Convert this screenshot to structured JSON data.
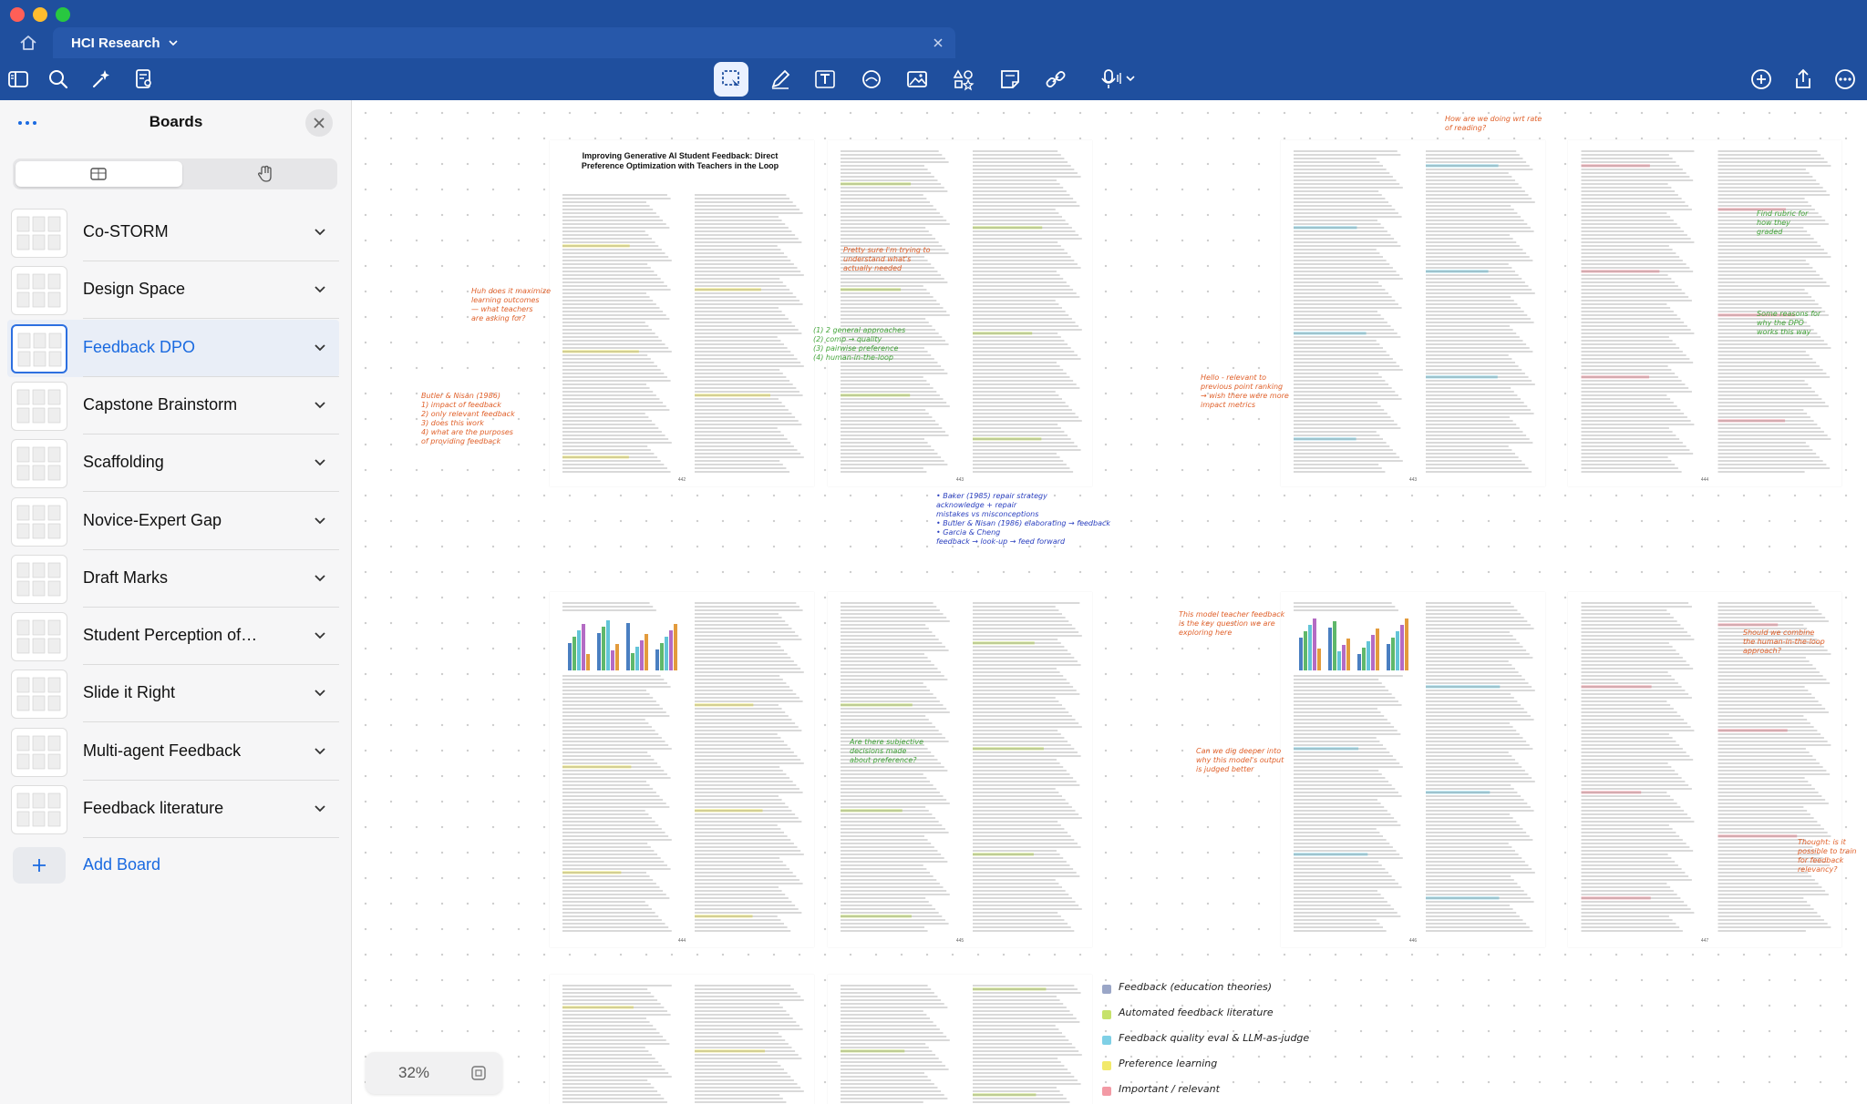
{
  "window": {
    "tab_title": "HCI Research"
  },
  "toolbar": {
    "left_icons": [
      "sidebar-icon",
      "search-icon",
      "sparkle-icon",
      "document-search-icon"
    ],
    "center_icons": [
      "lasso-icon",
      "pen-icon",
      "text-icon",
      "shape-icon",
      "image-icon",
      "elements-icon",
      "sticky-note-icon",
      "link-icon",
      "microphone-icon"
    ],
    "right_icons": [
      "add-icon",
      "share-icon",
      "more-icon"
    ],
    "accent": "#1f4f9e"
  },
  "sidebar": {
    "title": "Boards",
    "boards": [
      {
        "label": "Co-STORM",
        "active": false
      },
      {
        "label": "Design Space",
        "active": false
      },
      {
        "label": "Feedback DPO",
        "active": true
      },
      {
        "label": "Capstone Brainstorm",
        "active": false
      },
      {
        "label": "Scaffolding",
        "active": false
      },
      {
        "label": "Novice-Expert Gap",
        "active": false
      },
      {
        "label": "Draft Marks",
        "active": false
      },
      {
        "label": "Student Perception of…",
        "active": false
      },
      {
        "label": "Slide it Right",
        "active": false
      },
      {
        "label": "Multi-agent Feedback",
        "active": false
      },
      {
        "label": "Feedback literature",
        "active": false
      }
    ],
    "add_board_label": "Add Board",
    "active_color": "#1a6ae0"
  },
  "canvas": {
    "paper": {
      "title": "Improving Generative AI Student Feedback: Direct Preference Optimization with Teachers in the Loop",
      "authors": [
        "Juliette Woodrow",
        "Sanmi Koyejo",
        "Chris Piech"
      ],
      "affiliation": "Stanford University",
      "page_numbers": [
        "442",
        "443",
        "444",
        "445",
        "446",
        "447"
      ]
    },
    "sections": {
      "abstract": "ABSTRACT",
      "keywords": "Keywords",
      "intro": "1. INTRODUCTION",
      "methodology": "2. METHODOLOGY",
      "dpo": "2.1 Direct Preference Optimization",
      "experimental": "3. EXPERIMENTAL SETUP",
      "results": "4. RESULTS",
      "discussion": "5. DISCUSSION",
      "limitations": "6. LIMITATIONS",
      "future": "7. FUTURE WORK",
      "conclusion": "8. CONCLUSION",
      "ack": "9. ACKNOWLEDGEMENTS",
      "references": "10. REFERENCES"
    },
    "legend": [
      {
        "text": "Feedback (education theories)",
        "color": "#9aa6c7"
      },
      {
        "text": "Automated feedback literature",
        "color": "#c6e26b"
      },
      {
        "text": "Feedback quality eval & LLM-as-judge",
        "color": "#7fd0e6"
      },
      {
        "text": "Preference learning",
        "color": "#f2e96a"
      },
      {
        "text": "Important / relevant",
        "color": "#f39aa5"
      }
    ],
    "annotations": [
      {
        "text": "Huh does it maximize\nlearning outcomes\n— what teachers\nare asking for?",
        "color": "#e0602a"
      },
      {
        "text": "Butler & Nisan (1986)\n1) impact of feedback\n2) only relevant feedback\n3) does this work\n4) what are the purposes\n   of providing feedback",
        "color": "#e0602a"
      },
      {
        "text": "Pretty sure I'm trying to\nunderstand what's\nactually needed",
        "color": "#e0602a"
      },
      {
        "text": "(1) 2 general approaches\n(2) comp → quality\n(3) pairwise preference\n(4) human-in-the-loop",
        "color": "#44a63b"
      },
      {
        "text": "• Baker (1985) repair strategy\n  acknowledge + repair\n  mistakes vs misconceptions\n• Butler & Nisan (1986) elaborating → feedback\n• Garcia & Cheng\n  feedback → look-up → feed forward",
        "color": "#2a3fbf"
      },
      {
        "text": "Hello - relevant to\nprevious point ranking\n→ wish there were more\nimpact metrics",
        "color": "#e0602a"
      },
      {
        "text": "How are we doing wrt rate\nof reading?",
        "color": "#e0602a"
      },
      {
        "text": "Some reasons for\nwhy the DPO\nworks this way",
        "color": "#44a63b"
      },
      {
        "text": "Find rubric for\nhow they\ngraded",
        "color": "#44a63b"
      },
      {
        "text": "This model teacher feedback\nis the key question we are\nexploring here",
        "color": "#e0602a"
      },
      {
        "text": "Can we dig deeper into\nwhy this model's output\nis judged better",
        "color": "#e0602a"
      },
      {
        "text": "Are there subjective\ndecisions made\nabout preference?",
        "color": "#44a63b"
      },
      {
        "text": "Should we combine\nthe human-in-the-loop\napproach?",
        "color": "#e0602a"
      },
      {
        "text": "Thought: is it\npossible to train\nfor feedback\nrelevancy?",
        "color": "#e0602a"
      }
    ],
    "zoom": "32%"
  }
}
